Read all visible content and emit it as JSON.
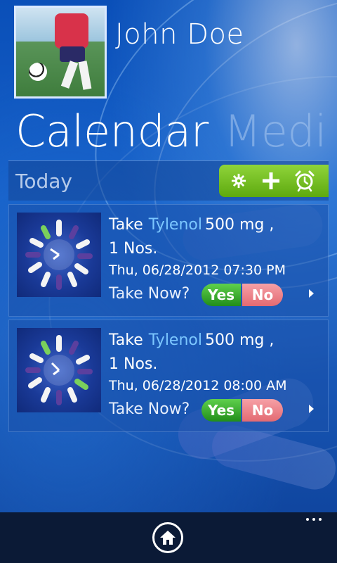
{
  "header": {
    "user_name": "John Doe"
  },
  "pivot": {
    "active": "Calendar",
    "next": "Medi"
  },
  "today": {
    "label": "Today",
    "toolbar": {
      "icons": [
        "gear-icon",
        "plus-icon",
        "alarm-clock-icon"
      ]
    }
  },
  "reminders": [
    {
      "take": "Take",
      "medicine": "Tylenol",
      "dose": "500 mg ,",
      "quantity": "1 Nos.",
      "datetime": "Thu, 06/28/2012 07:30 PM",
      "prompt": "Take Now?",
      "yes": "Yes",
      "no": "No"
    },
    {
      "take": "Take",
      "medicine": "Tylenol",
      "dose": "500 mg ,",
      "quantity": "1 Nos.",
      "datetime": "Thu, 06/28/2012 08:00 AM",
      "prompt": "Take Now?",
      "yes": "Yes",
      "no": "No"
    }
  ],
  "appbar": {
    "icons": [
      "home-icon",
      "more-icon"
    ]
  },
  "colors": {
    "accent_green": "#6cbf1f",
    "yes_green": "#2e9b20",
    "no_pink": "#eb7e86",
    "medicine_link": "#7cc7ff"
  }
}
